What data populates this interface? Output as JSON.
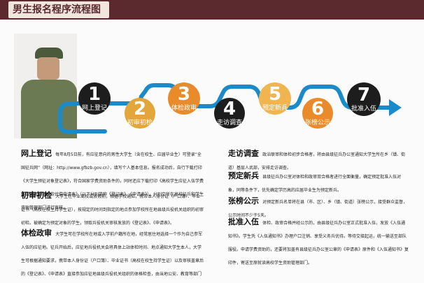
{
  "banner": {
    "title": "男生报名程序流程图"
  },
  "flow": {
    "steps": [
      {
        "num": "1",
        "label": "网上登记"
      },
      {
        "num": "2",
        "label": "初审初检"
      },
      {
        "num": "3",
        "label": "体检政审"
      },
      {
        "num": "4",
        "label": "走访调查"
      },
      {
        "num": "5",
        "label": "预定新兵"
      },
      {
        "num": "6",
        "label": "张榜公示"
      },
      {
        "num": "7",
        "label": "批准入伍"
      }
    ]
  },
  "sections": {
    "s1": {
      "title": "网上登记",
      "text": "每年8月5日前，有应征意向的男性大学生（含在校生、应届毕业生）可登录“全国征兵网”（网址：http://www.gfbzb.gov.cn），填写个人基本信息。报名成功后，自行下载打印《大学生预征对象登记表》，符合国家学费资助条件的，同时还应下载打印《高校学生应征入伍学费补偿国家助学贷款代偿申请表》（以下分别简称《登记表》、《申请表》），分别交所在高校征兵和学生资助管理部门进行审核。"
    },
    "s2": {
      "title": "初审初检",
      "text": "大学生在毕业离校或放假前，根据学校通知，携带本人身份证（户口簿）、毕业证书（高校在校生持学生证），按规定的时间到指定的地点参加学校所在地县级兵役机关组织的初审初检。被确定为预定对象的学生，领取兵役机关审核发放的《登记表》、《申请表》。"
    },
    "s3": {
      "title": "体检政审",
      "text": "大学生可在学校所在地或入学前户籍所在地，经常居住地选择一个作为自己参军入伍的应征地。征兵开始后，应征地兵役机关会将具体上站体检时间、地点通知大学生本人，大学生可根据通知要求，携带本人身份证（户口簿）、毕业证书（高校在校生持学生证）以及审核盖章后的《登记表》、《申请表》直接参加应征地县级兵役机关组织的体格检查，由当地公安、教育等部门同步展开政治联审工作。"
    },
    "s4": {
      "title": "走访调查",
      "text": "政治联审和体检初步合格者，将由县级征兵办公室通知大学生所在乡（镇、街道）基层人武部，安排走访调查。"
    },
    "s5": {
      "title": "预定新兵",
      "text": "县级征兵办公室对体检和政审双合格者进行全面衡量，确定预定批准入伍对象，同等条件下，优先确定学历高的应届毕业生为预定新兵。"
    },
    "s6": {
      "title": "张榜公示",
      "text": "对预定新兵名单将在县（市、区）、乡（镇、街道）张榜公示，接受群众监督，公示时间不少于5天。"
    },
    "s7": {
      "title": "批准入伍",
      "text": "体检、政审合格并经公示的，由县级征兵办公室正式批准入伍，发放《入伍通知书》。学生凭《入伍通知书》办理户口注销、享受义务兵优待。等待交接起运，统一输送至部队服役。申请学费资助的，还要将加盖有县级征兵办公室公章的《申请表》原件和《入伍通知书》复印件，寄送至原就读高校学生资助管理部门。"
    }
  },
  "colors": {
    "banner": "#5a2a2e",
    "path": "#1b8ac9",
    "orange": "#e98b2b",
    "black": "#1d1d1d"
  }
}
